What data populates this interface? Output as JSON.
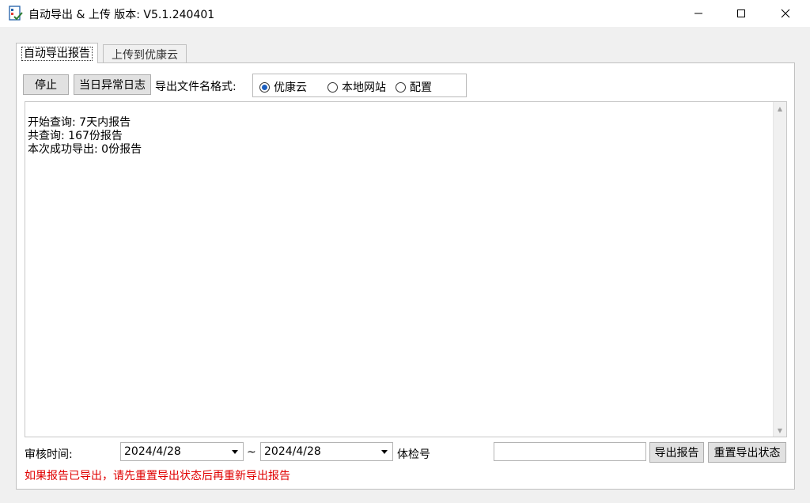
{
  "window": {
    "title": "自动导出 & 上传 版本: V5.1.240401"
  },
  "tabs": [
    {
      "label": "自动导出报告",
      "active": true
    },
    {
      "label": "上传到优康云",
      "active": false
    }
  ],
  "toolbar": {
    "stop_label": "停止",
    "daily_error_log_label": "当日异常日志",
    "filename_format_label": "导出文件名格式:",
    "options": [
      {
        "label": "优康云",
        "selected": true
      },
      {
        "label": "本地网站",
        "selected": false
      },
      {
        "label": "配置",
        "selected": false
      }
    ]
  },
  "log": {
    "lines": [
      "开始查询: 7天内报告",
      "共查询: 167份报告",
      "本次成功导出: 0份报告"
    ]
  },
  "filters": {
    "review_time_label": "审核时间:",
    "date_from": "2024/4/28",
    "separator": "~",
    "date_to": "2024/4/28",
    "exam_no_label": "体检号",
    "exam_no_value": ""
  },
  "actions": {
    "export_label": "导出报告",
    "reset_label": "重置导出状态"
  },
  "warning": "如果报告已导出，请先重置导出状态后再重新导出报告",
  "colors": {
    "warning": "#e00000",
    "radio_selected": "#1c5fbf"
  },
  "icons": {
    "app": "export-upload-app-icon",
    "minimize": "minimize-icon",
    "maximize": "maximize-icon",
    "close": "close-icon"
  }
}
